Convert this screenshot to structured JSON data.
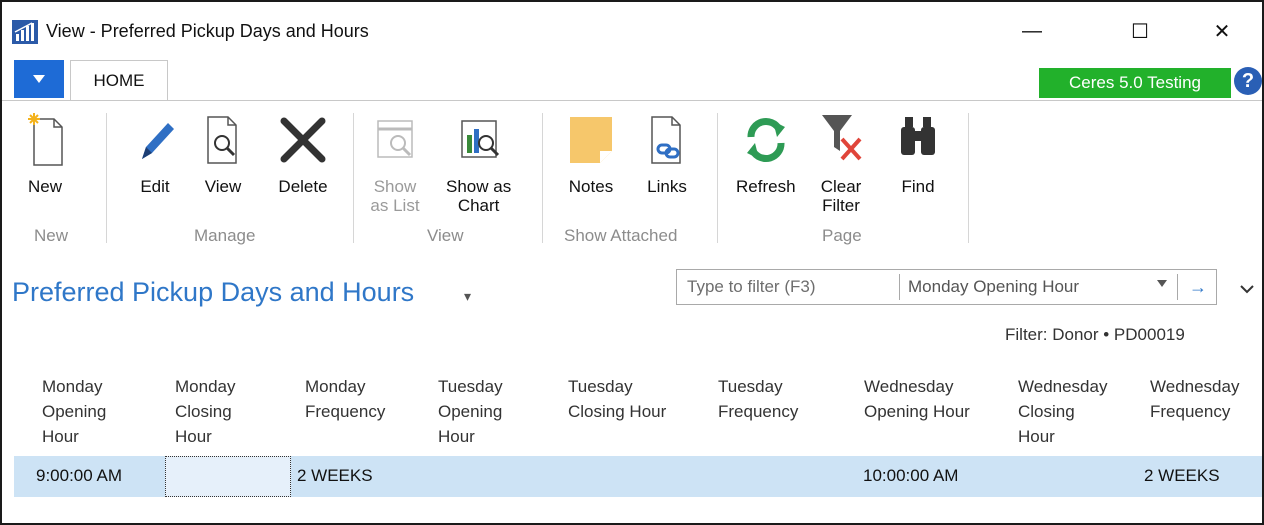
{
  "window": {
    "title": "View - Preferred Pickup Days and Hours",
    "minimize_glyph": "—",
    "maximize_glyph": "☐",
    "close_glyph": "✕"
  },
  "tabs": {
    "home_label": "HOME"
  },
  "environment_badge": "Ceres 5.0 Testing",
  "help_glyph": "?",
  "ribbon": {
    "new": {
      "label": "New",
      "group": "New"
    },
    "edit": {
      "label": "Edit"
    },
    "view": {
      "label": "View"
    },
    "delete": {
      "label": "Delete"
    },
    "manage_group": "Manage",
    "show_as_list": {
      "label": "Show\nas List"
    },
    "show_as_chart": {
      "label": "Show as\nChart"
    },
    "view_group": "View",
    "notes": {
      "label": "Notes"
    },
    "links": {
      "label": "Links"
    },
    "show_attached_group": "Show Attached",
    "refresh": {
      "label": "Refresh"
    },
    "clear_filter": {
      "label": "Clear\nFilter"
    },
    "find": {
      "label": "Find"
    },
    "page_group": "Page"
  },
  "page": {
    "title": "Preferred Pickup Days and Hours",
    "title_caret": "▾",
    "filter_placeholder": "Type to filter (F3)",
    "filter_field": "Monday Opening Hour",
    "filter_go": "→",
    "active_filter": "Filter: Donor • PD00019"
  },
  "columns": [
    "Monday\nOpening\nHour",
    "Monday\nClosing\nHour",
    "Monday\nFrequency",
    "Tuesday\nOpening\nHour",
    "Tuesday\nClosing Hour",
    "Tuesday\nFrequency",
    "Wednesday\nOpening Hour",
    "Wednesday\nClosing\nHour",
    "Wednesday\nFrequency"
  ],
  "row": {
    "monday_opening": "9:00:00 AM",
    "monday_closing": "",
    "monday_frequency": "2 WEEKS",
    "wednesday_opening": "10:00:00 AM",
    "wednesday_frequency": "2 WEEKS"
  },
  "colors": {
    "accent": "#2f77c8",
    "badge": "#22b12b",
    "app_menu": "#1e6bd6",
    "selected_row": "#cde3f5"
  }
}
